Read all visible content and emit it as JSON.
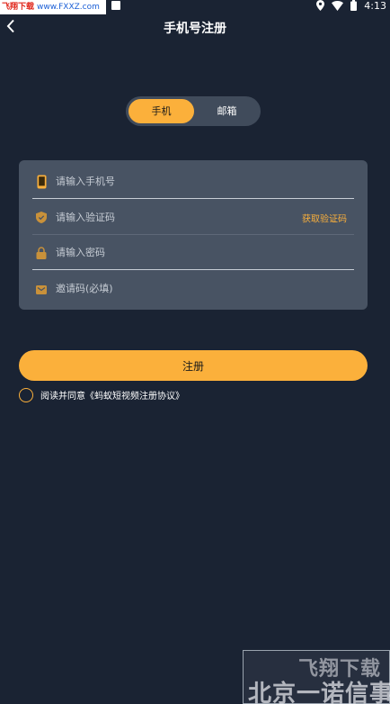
{
  "status_bar": {
    "watermark_part_a": "飞翔下载",
    "watermark_part_b": "www.FXXZ.com",
    "time": "4:13"
  },
  "header": {
    "back_icon": "chevron-left-icon",
    "title": "手机号注册"
  },
  "tabs": {
    "items": [
      {
        "label": "手机",
        "active": true
      },
      {
        "label": "邮箱",
        "active": false
      }
    ]
  },
  "form": {
    "phone": {
      "placeholder": "请输入手机号",
      "icon": "phone-icon"
    },
    "code": {
      "placeholder": "请输入验证码",
      "icon": "shield-icon",
      "action_label": "获取验证码"
    },
    "password": {
      "placeholder": "请输入密码",
      "icon": "lock-icon"
    },
    "invite": {
      "placeholder": "邀请码(必填)",
      "icon": "gift-icon"
    }
  },
  "register_button": {
    "label": "注册"
  },
  "agreement": {
    "text": "阅读并同意《蚂蚁短视频注册协议》",
    "checked": false
  },
  "watermark": {
    "line1": "飞翔下载",
    "line2": "北京一诺信事"
  },
  "colors": {
    "background": "#1a2333",
    "card": "#485363",
    "accent": "#fbb03b",
    "toggle_bg": "#404b5b"
  }
}
